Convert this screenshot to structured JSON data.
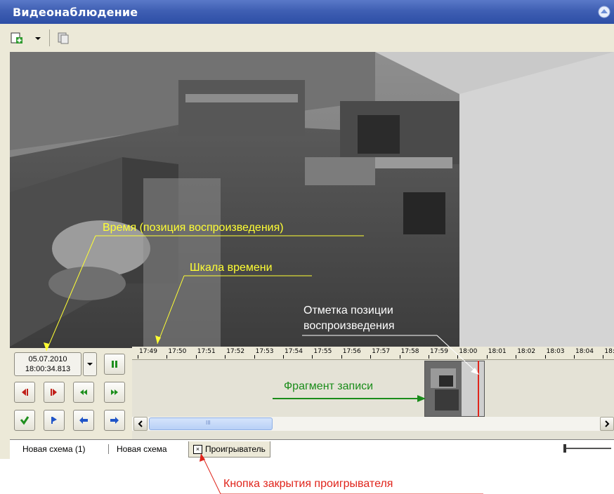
{
  "window": {
    "title": "Видеонаблюдение"
  },
  "toolbar": {
    "items": [
      "add-icon",
      "dropdown-arrow-icon",
      "copy-icon"
    ]
  },
  "player": {
    "date": "05.07.2010",
    "time": "18:00:34.813",
    "controls": [
      "pause-icon",
      "step-back-icon",
      "step-forward-icon",
      "rewind-icon",
      "fast-forward-icon",
      "download-icon",
      "play-icon",
      "prev-icon",
      "next-icon"
    ]
  },
  "timeline": {
    "ticks": [
      "17:49",
      "17:50",
      "17:51",
      "17:52",
      "17:53",
      "17:54",
      "17:55",
      "17:56",
      "17:57",
      "17:58",
      "17:59",
      "18:00",
      "18:01",
      "18:02",
      "18:03",
      "18:04",
      "18:"
    ],
    "scroll_thumb_label": "III"
  },
  "tabs": [
    {
      "label": "Новая схема (1)"
    },
    {
      "label": "Новая схема"
    },
    {
      "label": "Проигрыватель",
      "close_label": "×"
    }
  ],
  "annotations": {
    "time_position": "Время (позиция воспроизведения)",
    "timescale": "Шкала времени",
    "marker_line1": "Отметка позиции",
    "marker_line2": "воспроизведения",
    "fragment": "Фрагмент записи",
    "close_button": "Кнопка закрытия проигрывателя"
  },
  "colors": {
    "titlebar": "#3f5fb3",
    "annotation_yellow": "#ffff33",
    "annotation_green": "#1a8c1a",
    "annotation_red": "#e0241b",
    "control_red": "#c0201a",
    "control_green": "#1e8f1e",
    "control_blue": "#1f54c8"
  }
}
